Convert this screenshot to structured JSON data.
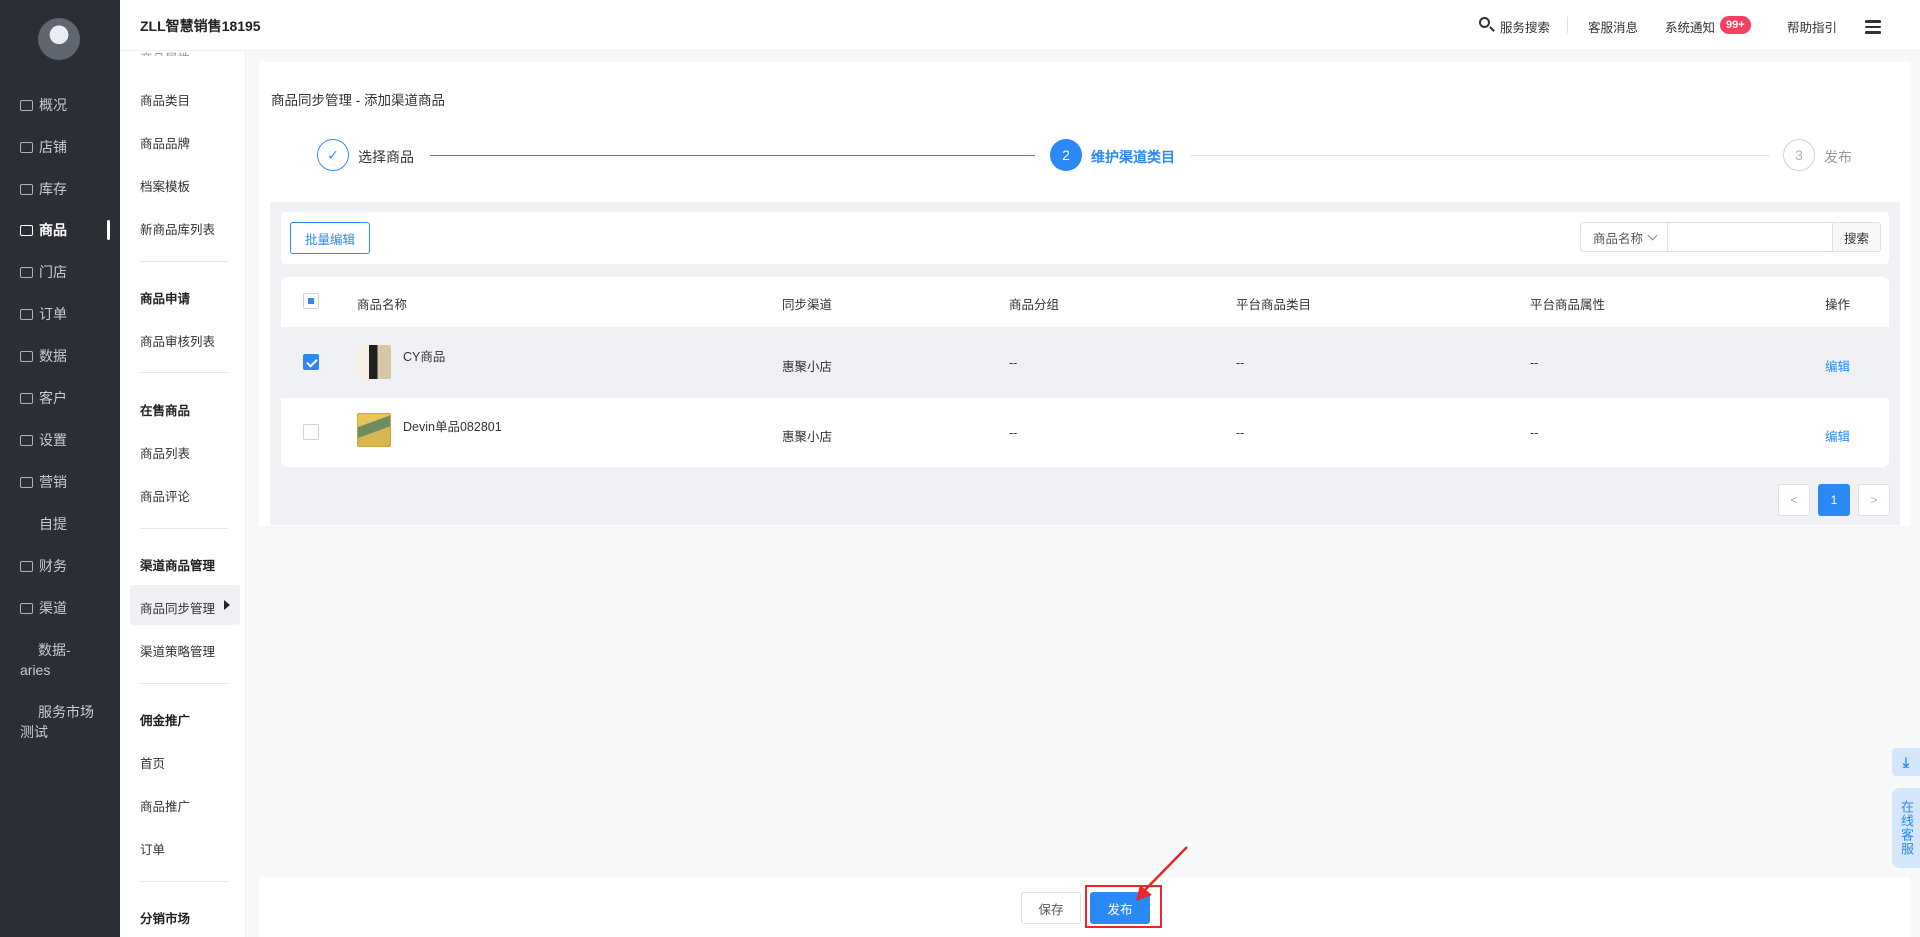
{
  "app": {
    "brand": "ZLL智慧销售18195"
  },
  "topbar": {
    "search": "服务搜索",
    "cs_message": "客服消息",
    "notifications": "系统通知",
    "notifications_badge": "99+",
    "help": "帮助指引"
  },
  "nav": {
    "items": [
      "概况",
      "店铺",
      "库存",
      "商品",
      "门店",
      "订单",
      "数据",
      "客户",
      "设置",
      "营销",
      "自提",
      "财务",
      "渠道"
    ],
    "extra1_line1": "数据-",
    "extra1_line2": "aries",
    "extra2_line1": "服务市场",
    "extra2_line2": "测试"
  },
  "subnav": {
    "cut_top": "商品属性",
    "g1": [
      "商品类目",
      "商品品牌",
      "档案模板",
      "新商品库列表"
    ],
    "h2": "商品申请",
    "g2": [
      "商品审核列表"
    ],
    "h3": "在售商品",
    "g3": [
      "商品列表",
      "商品评论"
    ],
    "h4": "渠道商品管理",
    "g4": [
      "商品同步管理",
      "渠道策略管理"
    ],
    "h5": "佣金推广",
    "g5": [
      "首页",
      "商品推广",
      "订单"
    ],
    "h6": "分销市场"
  },
  "breadcrumb": "商品同步管理 - 添加渠道商品",
  "steps": [
    {
      "label": "选择商品",
      "state": "done"
    },
    {
      "label": "维护渠道类目",
      "number": "2",
      "state": "active"
    },
    {
      "label": "发布",
      "number": "3",
      "state": "pending"
    }
  ],
  "toolbar": {
    "batch_edit": "批量编辑",
    "search_field": "商品名称",
    "search_value": "",
    "search_button": "搜索"
  },
  "table": {
    "headers": [
      "商品名称",
      "同步渠道",
      "商品分组",
      "平台商品类目",
      "平台商品属性",
      "操作"
    ],
    "rows": [
      {
        "checked": true,
        "name": "CY商品",
        "channel": "惠聚小店",
        "group": "--",
        "category": "--",
        "attribute": "--",
        "action": "编辑"
      },
      {
        "checked": false,
        "name": "Devin单品082801",
        "channel": "惠聚小店",
        "group": "--",
        "category": "--",
        "attribute": "--",
        "action": "编辑"
      }
    ]
  },
  "pagination": {
    "current": "1"
  },
  "footer": {
    "save": "保存",
    "publish": "发布"
  },
  "float": {
    "customer_service": "在线客服"
  },
  "colors": {
    "primary": "#2b89f5",
    "sidebar_bg": "#2b2e35",
    "highlight": "#e9262a",
    "badge": "#f5405f"
  },
  "icons": [
    "overview-icon",
    "store-icon",
    "inventory-icon",
    "goods-icon",
    "shop-icon",
    "order-icon",
    "data-icon",
    "customer-icon",
    "settings-icon",
    "marketing-icon",
    "finance-icon",
    "channel-icon",
    "search-icon",
    "menu-icon",
    "check-icon",
    "download-icon"
  ]
}
